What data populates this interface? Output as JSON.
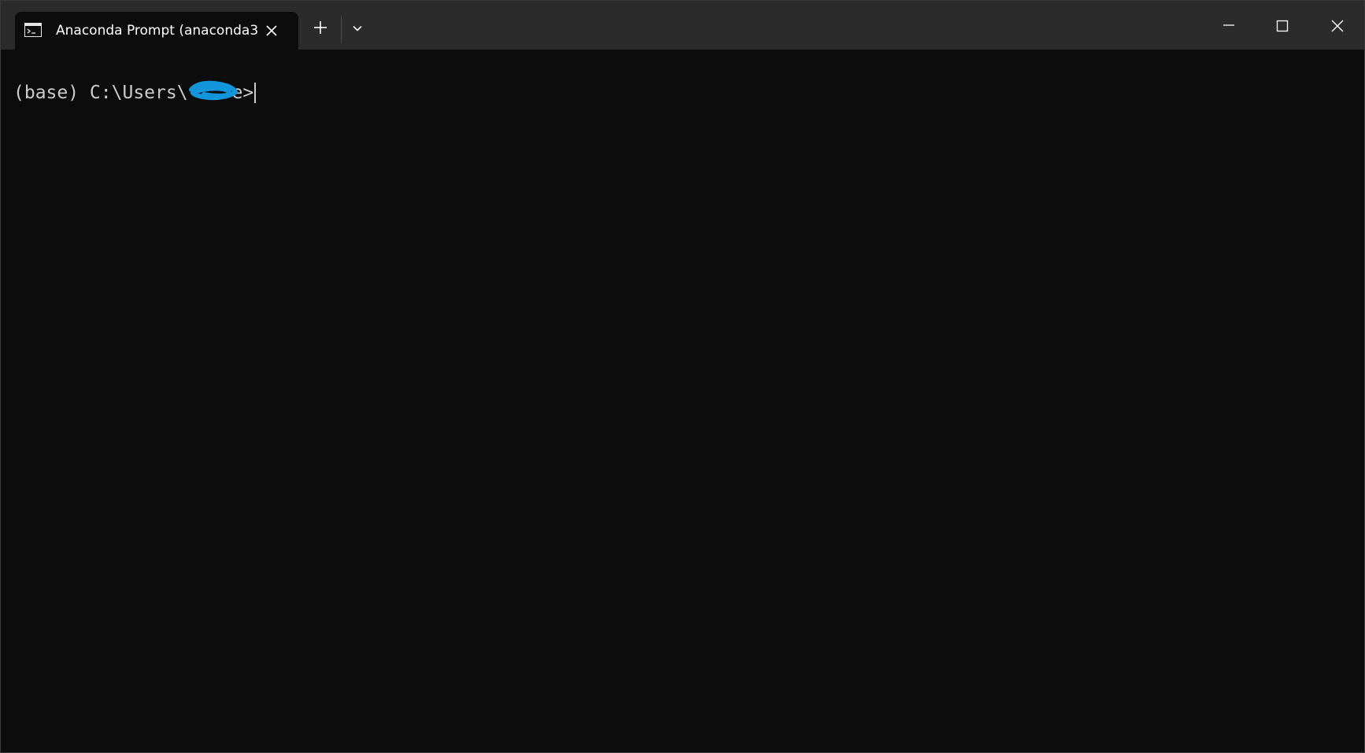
{
  "window": {
    "tab_title": "Anaconda Prompt (anaconda3",
    "icons": {
      "tab_icon": "terminal-icon",
      "tab_close": "close-icon",
      "new_tab": "plus-icon",
      "dropdown": "chevron-down-icon",
      "minimize": "minimize-icon",
      "maximize": "maximize-icon",
      "close": "close-icon"
    }
  },
  "terminal": {
    "prompt": "(base) C:\\Users\\",
    "prompt_suffix": "e>"
  },
  "colors": {
    "titlebar": "#2b2b2b",
    "background": "#0c0c0c",
    "text": "#cccccc",
    "redaction": "#1296db"
  }
}
